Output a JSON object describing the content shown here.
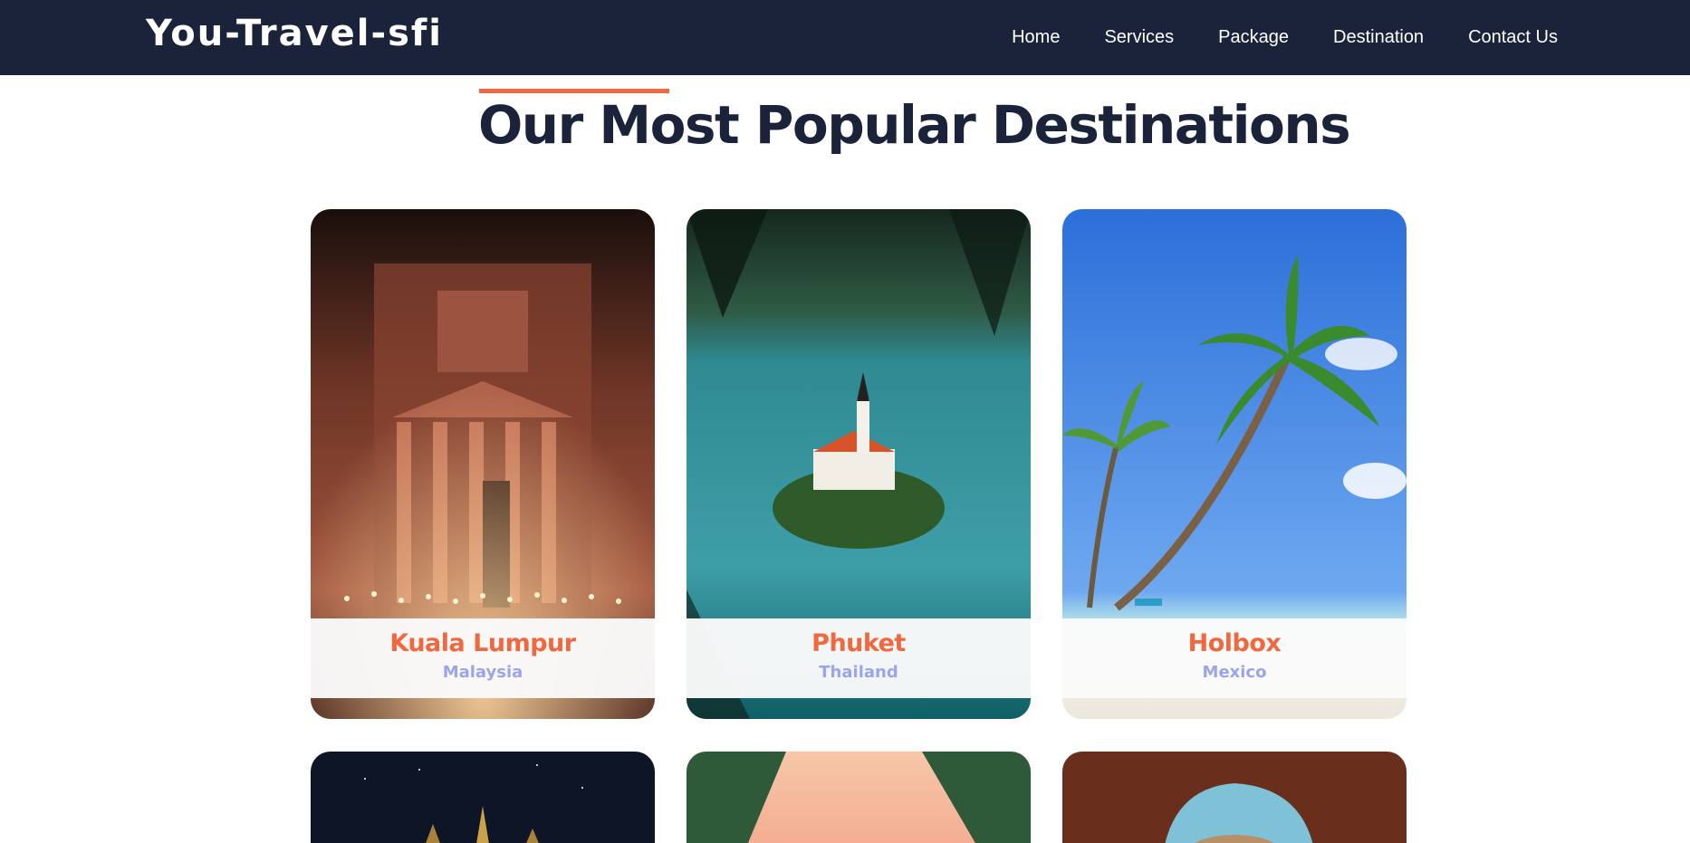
{
  "header": {
    "brand": "You-Travel-sfi",
    "nav": [
      "Home",
      "Services",
      "Package",
      "Destination",
      "Contact Us"
    ]
  },
  "section": {
    "title": "Our Most Popular Destinations"
  },
  "destinations": [
    {
      "name": "Kuala Lumpur",
      "country": "Malaysia",
      "image": "petra-treasury-candles"
    },
    {
      "name": "Phuket",
      "country": "Thailand",
      "image": "lake-island-church"
    },
    {
      "name": "Holbox",
      "country": "Mexico",
      "image": "palm-beach"
    }
  ],
  "partial_cards": [
    {
      "image": "golden-temple-night"
    },
    {
      "image": "sunset-foliage"
    },
    {
      "image": "rock-arch-sea"
    }
  ],
  "colors": {
    "nav_bg": "#1b233a",
    "accent": "#f0683f",
    "title": "#1b233a",
    "country": "#9aa6e8"
  }
}
